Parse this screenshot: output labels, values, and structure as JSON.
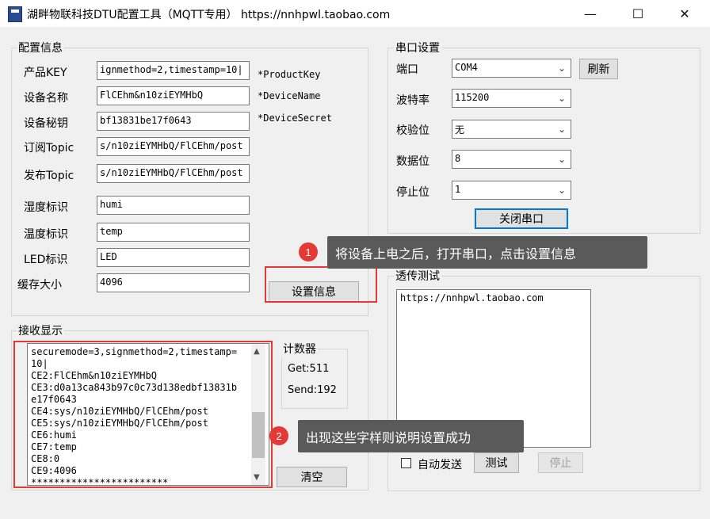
{
  "window": {
    "title": "湖畔物联科技DTU配置工具（MQTT专用）  https://nnhpwl.taobao.com",
    "minimize": "—",
    "maximize": "☐",
    "close": "✕"
  },
  "config": {
    "group_label": "配置信息",
    "fields": [
      {
        "label": "产品KEY",
        "value": "ignmethod=2,timestamp=10|",
        "hint": "*ProductKey"
      },
      {
        "label": "设备名称",
        "value": "FlCEhm&n10ziEYMHbQ",
        "hint": "*DeviceName"
      },
      {
        "label": "设备秘钥",
        "value": "bf13831be17f0643",
        "hint": "*DeviceSecret"
      },
      {
        "label": "订阅Topic",
        "value": "s/n10ziEYMHbQ/FlCEhm/post"
      },
      {
        "label": "发布Topic",
        "value": "s/n10ziEYMHbQ/FlCEhm/post"
      },
      {
        "label": "湿度标识",
        "value": "humi"
      },
      {
        "label": "温度标识",
        "value": "temp"
      },
      {
        "label": "LED标识",
        "value": "LED"
      },
      {
        "label": "缓存大小",
        "value": "4096"
      }
    ],
    "set_button": "设置信息"
  },
  "serial": {
    "group_label": "串口设置",
    "port_label": "端口",
    "port_value": "COM4",
    "refresh_button": "刷新",
    "baud_label": "波特率",
    "baud_value": "115200",
    "parity_label": "校验位",
    "parity_value": "无",
    "databits_label": "数据位",
    "databits_value": "8",
    "stopbits_label": "停止位",
    "stopbits_value": "1",
    "close_port_button": "关闭串口"
  },
  "passthrough": {
    "group_label": "透传测试",
    "text": "https://nnhpwl.taobao.com",
    "auto_send_label": "自动发送",
    "test_button": "测试",
    "stop_button": "停止"
  },
  "receive": {
    "group_label": "接收显示",
    "lines": [
      "securemode=3,signmethod=2,timestamp=",
      "10|",
      "CE2:FlCEhm&n10ziEYMHbQ",
      "CE3:d0a13ca843b97c0c73d138edbf13831b",
      "e17f0643",
      "CE4:sys/n10ziEYMHbQ/FlCEhm/post",
      "CE5:sys/n10ziEYMHbQ/FlCEhm/post",
      "CE6:humi",
      "CE7:temp",
      "CE8:0",
      "CE9:4096",
      "************************"
    ],
    "clear_button": "清空"
  },
  "counter": {
    "group_label": "计数器",
    "get": "Get:511",
    "send": "Send:192"
  },
  "annotations": {
    "callout1_num": "1",
    "callout1_text": "将设备上电之后，打开串口，点击设置信息",
    "callout2_num": "2",
    "callout2_text": "出现这些字样则说明设置成功",
    "red": "#e53935"
  }
}
